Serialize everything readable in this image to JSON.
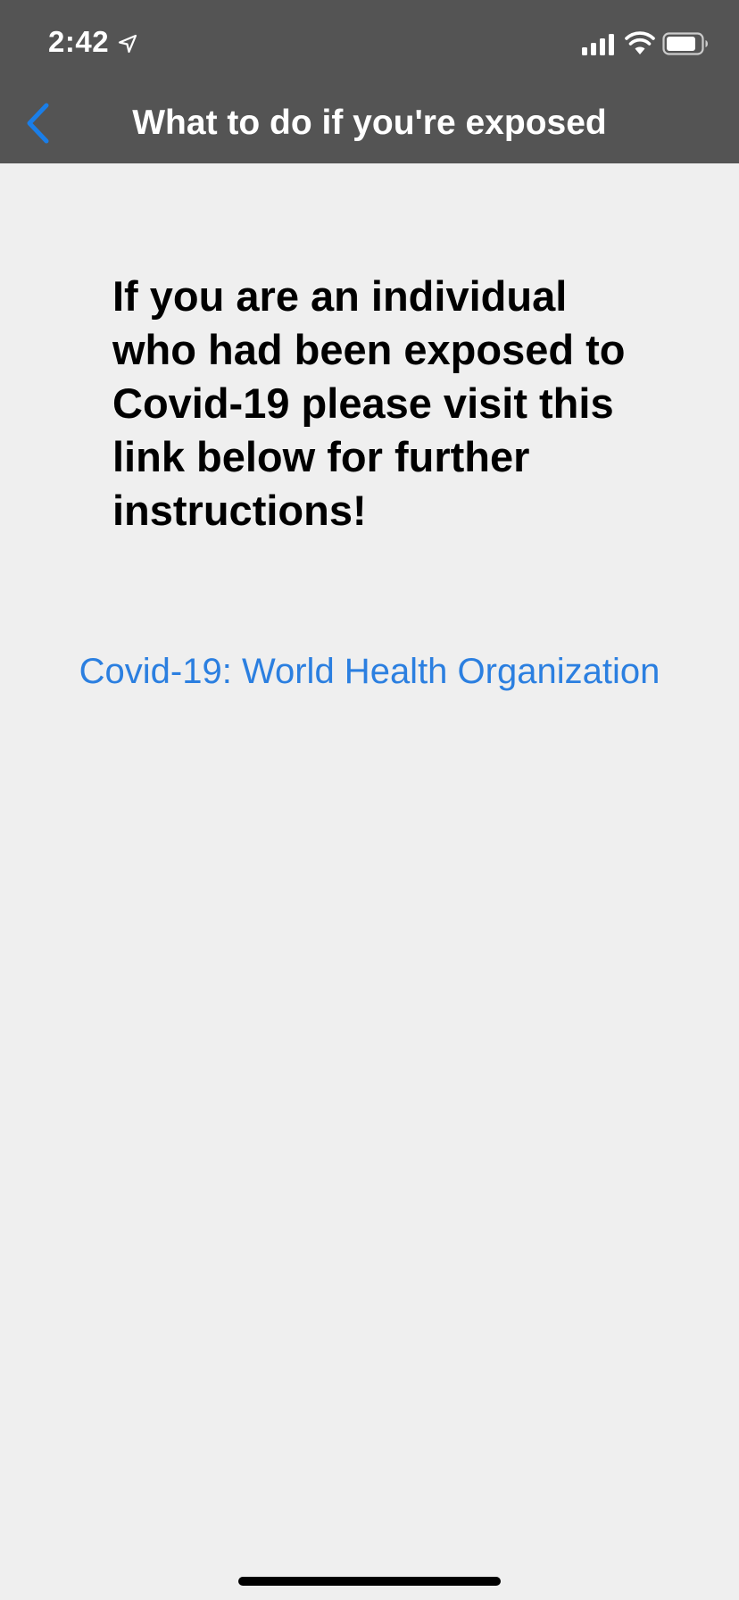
{
  "status_bar": {
    "time": "2:42",
    "icons": [
      "location-arrow-icon",
      "cellular-signal-icon",
      "wifi-icon",
      "battery-icon"
    ]
  },
  "nav": {
    "title": "What to do if you're exposed",
    "back_icon": "chevron-left-icon"
  },
  "main": {
    "message": "If you are an individual who had been exposed to Covid-19 please visit this link below for further instructions!",
    "link_label": "Covid-19: World Health Organization"
  },
  "colors": {
    "nav_background": "#545454",
    "page_background": "#efefef",
    "link": "#2b7fe0",
    "back_chevron": "#1a7ee8"
  }
}
